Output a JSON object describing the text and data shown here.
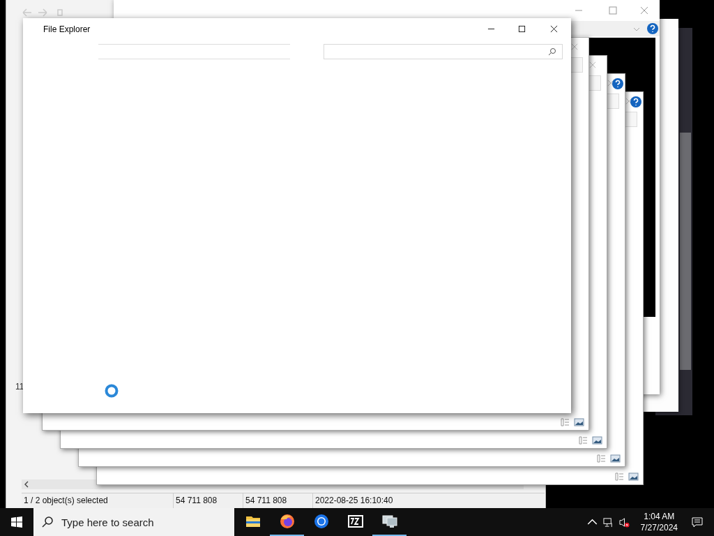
{
  "back_window": {
    "fragment": "11",
    "status_bar": [
      "1 / 2 object(s) selected",
      "54 711 808",
      "54 711 808",
      "2022-08-25 16:10:40"
    ]
  },
  "dialogs": [
    {
      "help": false
    },
    {
      "help": false
    },
    {
      "help": true
    },
    {
      "help": true
    }
  ],
  "main_window": {
    "title": "File Explorer",
    "loading": true
  },
  "taskbar": {
    "search": {
      "placeholder": "Type here to search"
    },
    "apps": [
      {
        "kind": "folder",
        "running": false
      },
      {
        "kind": "firefox",
        "running": true
      },
      {
        "kind": "chrome",
        "running": false
      },
      {
        "kind": "sevenzip",
        "running": false
      },
      {
        "kind": "monitor",
        "running": true
      }
    ],
    "clock": {
      "time": "1:04 AM",
      "date": "7/27/2024"
    }
  }
}
